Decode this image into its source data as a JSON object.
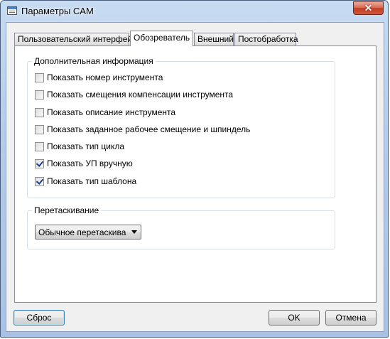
{
  "window": {
    "title": "Параметры CAM",
    "close_glyph": "✕"
  },
  "tabs": [
    {
      "label": "Пользовательский интерфейс",
      "active": false
    },
    {
      "label": "Обозреватель",
      "active": true
    },
    {
      "label": "Внешний",
      "active": false
    },
    {
      "label": "Постобработка",
      "active": false
    }
  ],
  "info_group": {
    "title": "Дополнительная информация",
    "options": [
      {
        "label": "Показать номер инструмента",
        "checked": false
      },
      {
        "label": "Показать смещения компенсации инструмента",
        "checked": false
      },
      {
        "label": "Показать описание инструмента",
        "checked": false
      },
      {
        "label": "Показать заданное рабочее смещение и шпиндель",
        "checked": false
      },
      {
        "label": "Показать тип цикла",
        "checked": false
      },
      {
        "label": "Показать УП вручную",
        "checked": true
      },
      {
        "label": "Показать тип шаблона",
        "checked": true
      }
    ]
  },
  "drag_group": {
    "title": "Перетаскивание",
    "select_value": "Обычное перетаскивани"
  },
  "buttons": {
    "reset": "Сброс",
    "ok": "OK",
    "cancel": "Отмена"
  }
}
